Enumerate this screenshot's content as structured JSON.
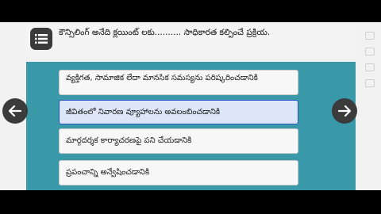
{
  "question": {
    "menu_icon": "list-icon",
    "text": "కౌన్సిలింగ్ అనేది క్లయింట్ లకు.......... సాధికారత కల్పించే ప్రక్రియ."
  },
  "options": [
    {
      "label": "వ్యక్తిగత, సామాజిక లేదా మానసిక సమస్యను పరిష్కరించడానికి",
      "selected": false
    },
    {
      "label": "జీవితంలో నివారణ వ్యూహాలను అవలంబించడానికి",
      "selected": true
    },
    {
      "label": "మార్గదర్శక కార్యాచరణపై పని చేయడానికి",
      "selected": false
    },
    {
      "label": "ప్రపంచాన్ని అన్వేషించడానికి",
      "selected": false
    }
  ],
  "navigation": {
    "prev_icon": "arrow-left-icon",
    "next_icon": "arrow-right-icon"
  },
  "colors": {
    "panel": "#3a99a8",
    "selected_border": "#2a56c6",
    "selected_fill": "#dce6f8",
    "nav_button": "#3b3b3b"
  }
}
